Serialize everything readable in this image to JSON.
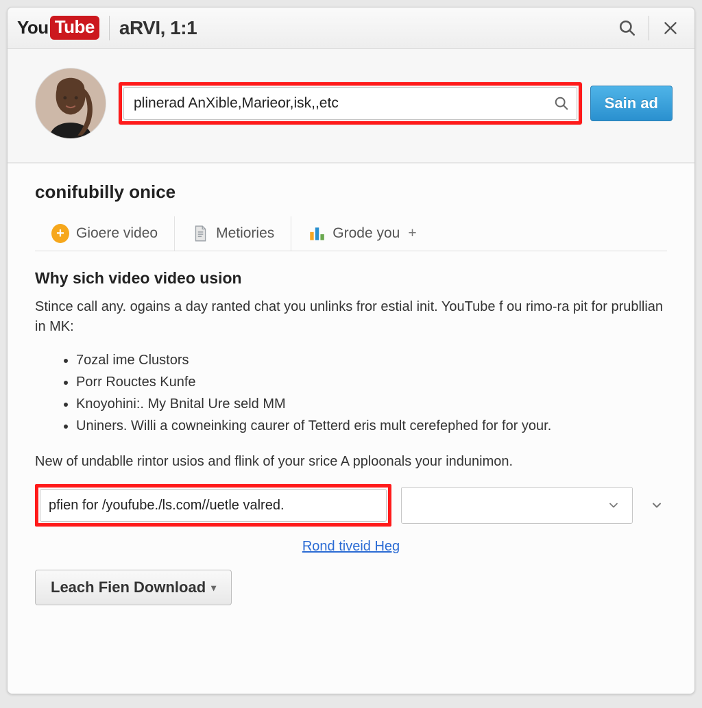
{
  "titlebar": {
    "logo_you": "You",
    "logo_tube": "Tube",
    "title": "aRVI, 1:1"
  },
  "search": {
    "placeholder": "plinerad AnXible,Marieor,isk,,etc",
    "button_label": "Sain ad"
  },
  "section": {
    "title": "conifubilly onice"
  },
  "tabs": [
    {
      "label": "Gioere video",
      "plus": ""
    },
    {
      "label": "Metiories",
      "plus": ""
    },
    {
      "label": "Grode you",
      "plus": "+"
    }
  ],
  "content": {
    "heading": "Why sich video video usion",
    "intro": "Stince call any. ogains a day ranted chat you unlinks fror estial init. YouTube f ou rimo-ra pit for prubllian in MK:",
    "bullets": [
      "7ozal ime Clustors",
      "Porr Rouctes Kunfe",
      "Knoyohini:. My Bnital Ure seld MM",
      "Uniners. Willi a cowneinking caurer of Tetterd eris mult cerefephed for for your."
    ],
    "outro": "New of undablle rintor usios and flink of your srice A pploonals your indunimon.",
    "url_value": "pfien for /youfube./ls.com//uetle valred.",
    "help_link": "Rond tiveid Heg",
    "download_button": "Leach Fien Download"
  },
  "icons": {
    "search": "search-icon",
    "close": "close-icon",
    "chevron_down": "chevron-down-icon",
    "plus": "plus-icon",
    "document": "document-icon",
    "bars": "bars-icon"
  },
  "colors": {
    "highlight": "#ff1a1a",
    "primary": "#2a90cf",
    "link": "#2a6bd4",
    "brand_red": "#cc181e",
    "accent_orange": "#f6a71c"
  }
}
